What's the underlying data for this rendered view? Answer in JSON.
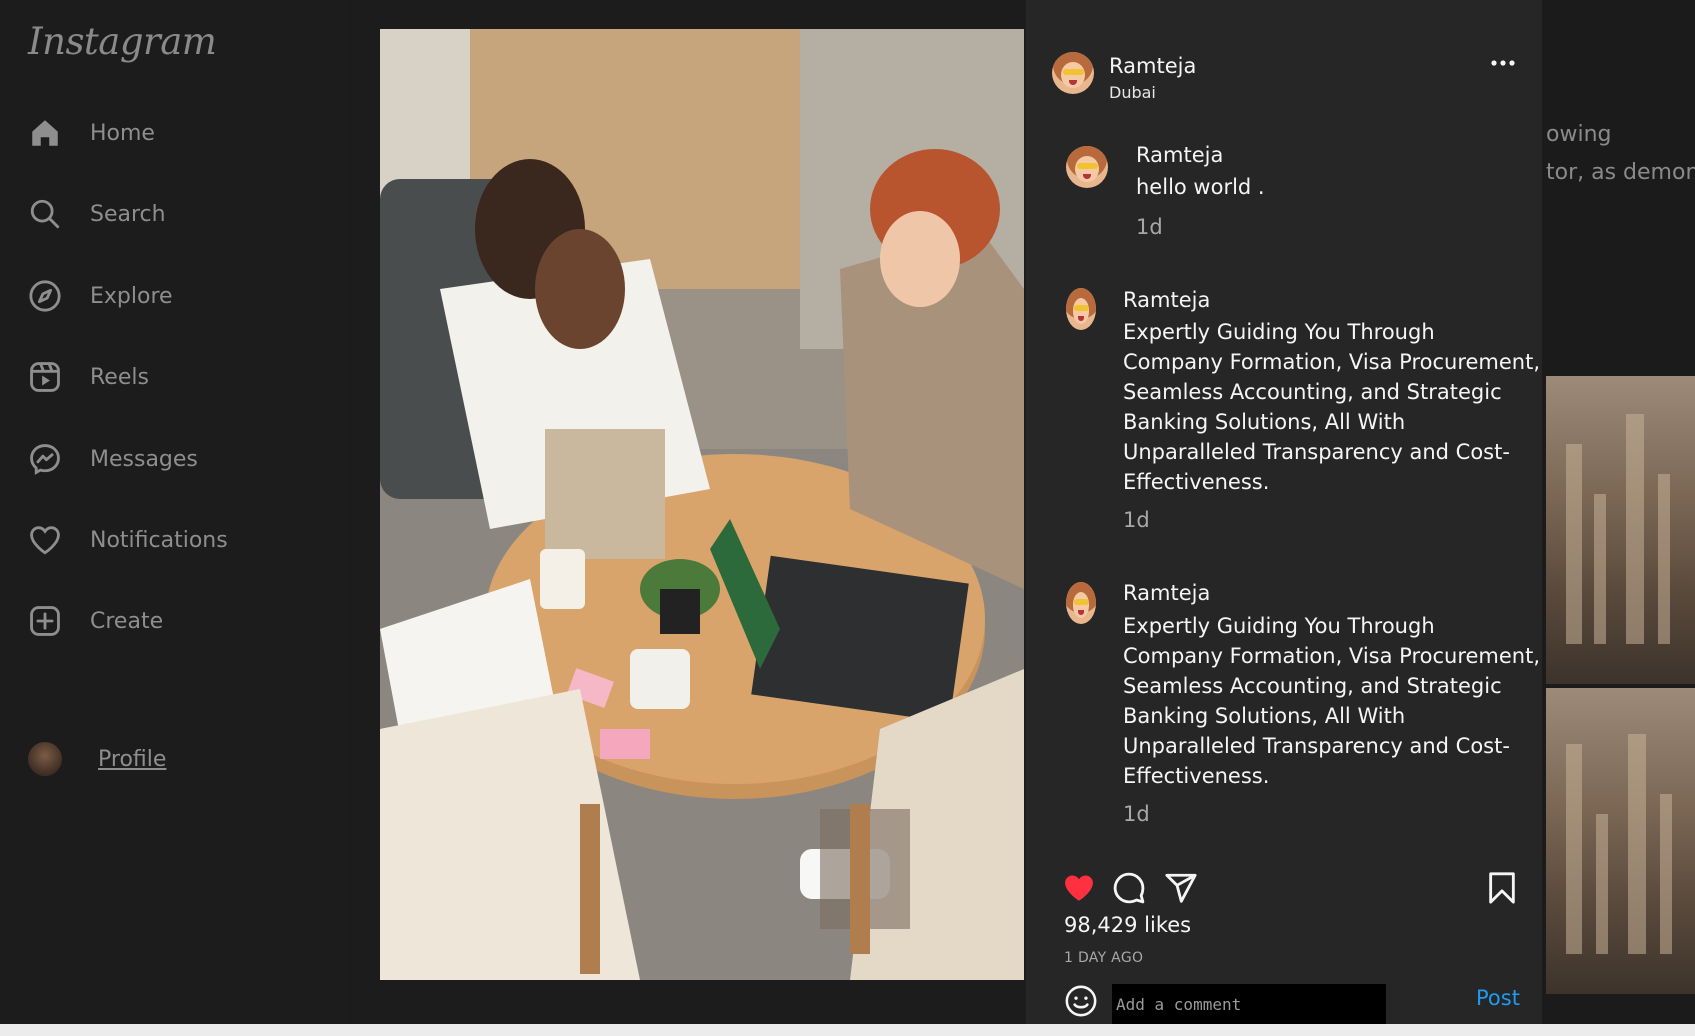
{
  "app": {
    "logo": "Instagram"
  },
  "sidebar": {
    "items": [
      {
        "label": "Home",
        "icon": "home-icon"
      },
      {
        "label": "Search",
        "icon": "search-icon"
      },
      {
        "label": "Explore",
        "icon": "compass-icon"
      },
      {
        "label": "Reels",
        "icon": "reels-icon"
      },
      {
        "label": "Messages",
        "icon": "messenger-icon"
      },
      {
        "label": "Notifications",
        "icon": "heart-icon"
      },
      {
        "label": "Create",
        "icon": "plus-square-icon"
      },
      {
        "label": "Profile",
        "icon": "avatar"
      }
    ]
  },
  "background": {
    "partial_text_1": "owing",
    "partial_text_2": "tor, as demonst"
  },
  "post": {
    "author": "Ramteja",
    "location": "Dubai",
    "comments": [
      {
        "user": "Ramteja",
        "text": "hello world .",
        "time": "1d"
      },
      {
        "user": "Ramteja",
        "text": "Expertly Guiding You Through\nCompany Formation, Visa Procurement,\nSeamless Accounting, and Strategic\nBanking Solutions, All With\nUnparalleled Transparency and Cost-\nEffectiveness.",
        "time": "1d"
      },
      {
        "user": "Ramteja",
        "text": "Expertly Guiding You Through\nCompany Formation, Visa Procurement,\nSeamless Accounting, and Strategic\nBanking Solutions, All With\nUnparalleled Transparency and Cost-\nEffectiveness.",
        "time": "1d"
      }
    ],
    "likes": "98,429 likes",
    "posted": "1 DAY AGO",
    "liked": true,
    "comment_placeholder": "Add a comment",
    "post_label": "Post",
    "colors": {
      "like": "#ff3040",
      "link": "#1e9bf0"
    }
  }
}
